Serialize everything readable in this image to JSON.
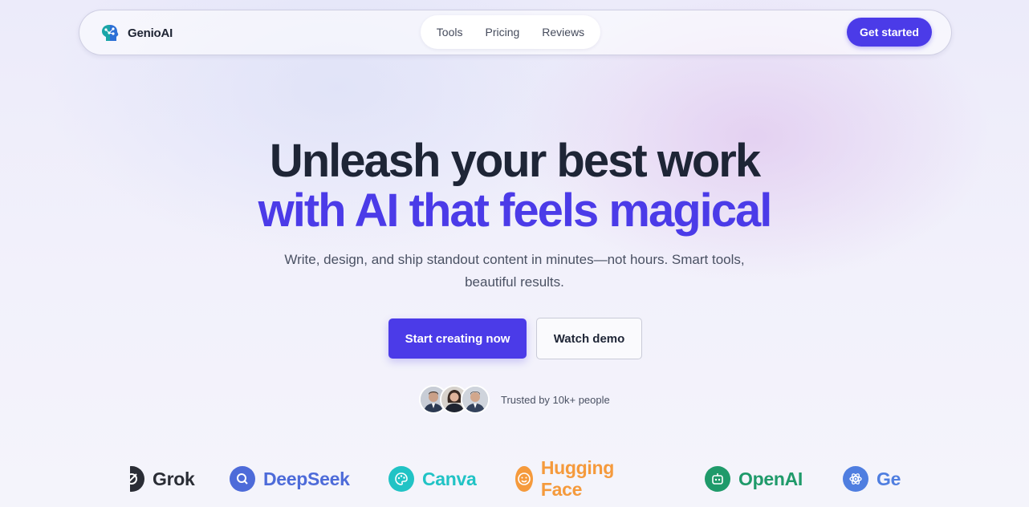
{
  "brand": {
    "name": "GenioAI",
    "icon": "brain-icon"
  },
  "nav": {
    "links": [
      "Tools",
      "Pricing",
      "Reviews"
    ],
    "cta_label": "Get started"
  },
  "hero": {
    "line1": "Unleash your best work",
    "line2": "with AI that feels magical",
    "subtitle": "Write, design, and ship standout content in minutes—not hours. Smart tools, beautiful results.",
    "primary_label": "Start creating now",
    "secondary_label": "Watch demo",
    "trust_text": "Trusted by 10k+ people"
  },
  "logos": [
    {
      "name": "Grok",
      "icon": "grok-icon",
      "color": "#2a2d35"
    },
    {
      "name": "DeepSeek",
      "icon": "search-icon",
      "color": "#4d6bd9"
    },
    {
      "name": "Canva",
      "icon": "palette-icon",
      "color": "#21c3c5"
    },
    {
      "name": "Hugging Face",
      "icon": "smile-icon",
      "color": "#f59a3c"
    },
    {
      "name": "OpenAI",
      "icon": "robot-icon",
      "color": "#1f9a6a"
    },
    {
      "name": "Ge",
      "icon": "atom-icon",
      "color": "#4f7ee0"
    }
  ],
  "colors": {
    "accent": "#4b3be8",
    "heading": "#1e2536",
    "text": "#4a5163"
  }
}
